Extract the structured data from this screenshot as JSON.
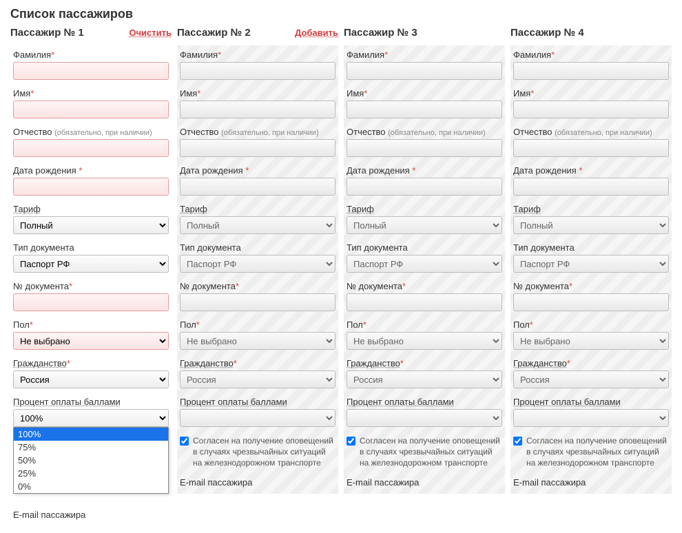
{
  "page_title": "Список пассажиров",
  "labels": {
    "surname": "Фамилия",
    "name": "Имя",
    "patronymic": "Отчество",
    "patronymic_hint": "(обязательно, при наличии)",
    "dob": "Дата рождения",
    "tariff": "Тариф",
    "doc_type": "Тип документа",
    "doc_no": "№ документа",
    "gender": "Пол",
    "citizenship": "Гражданство",
    "points_percent": "Процент оплаты баллами",
    "consent": "Согласен на получение оповещений в случаях чрезвычайных ситуаций на железнодорожном транспорте",
    "email": "E-mail пассажира"
  },
  "values": {
    "tariff": "Полный",
    "doc_type": "Паспорт РФ",
    "gender": "Не выбрано",
    "citizenship": "Россия",
    "points_percent": "100%"
  },
  "points_options": [
    "100%",
    "75%",
    "50%",
    "25%",
    "0%"
  ],
  "passengers": [
    {
      "title": "Пассажир № 1",
      "action": "Очистить",
      "first": true
    },
    {
      "title": "Пассажир № 2",
      "action": "Добавить",
      "first": false
    },
    {
      "title": "Пассажир № 3",
      "action": "",
      "first": false
    },
    {
      "title": "Пассажир № 4",
      "action": "",
      "first": false
    }
  ]
}
